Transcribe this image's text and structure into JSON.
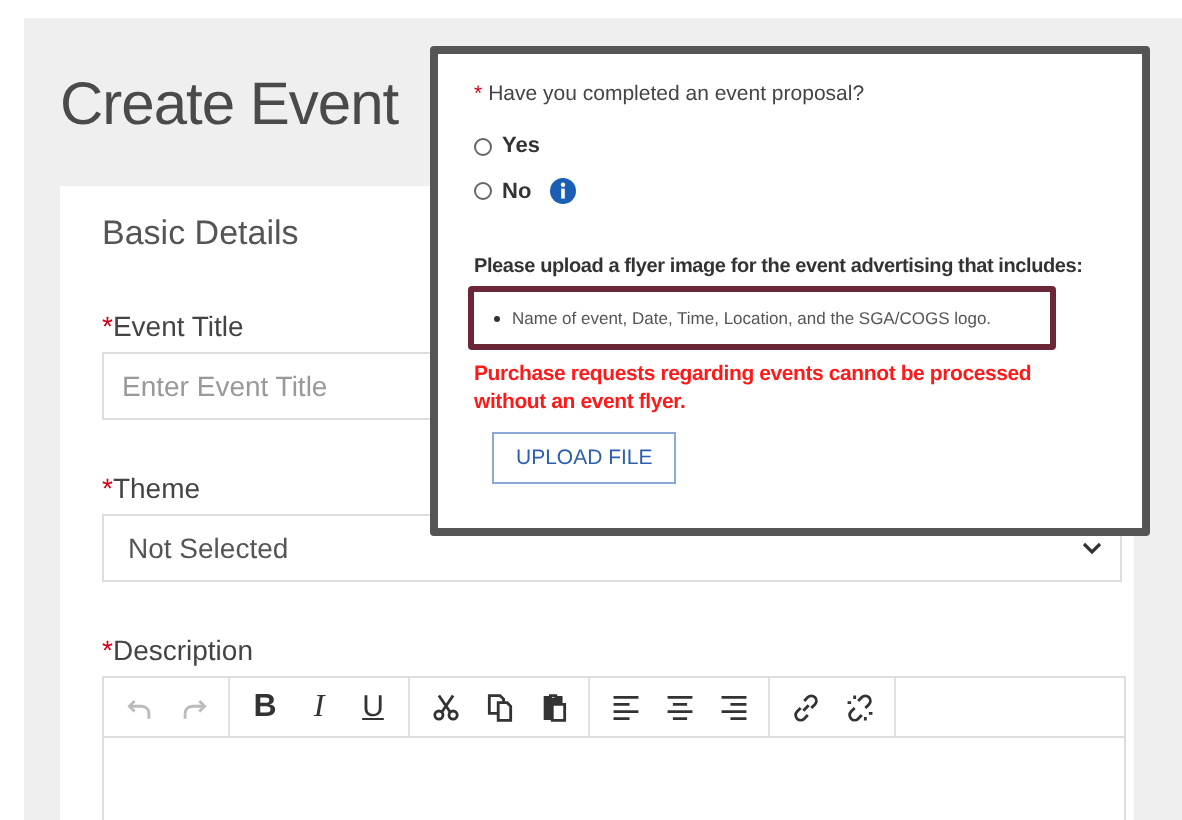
{
  "page": {
    "title": "Create Event"
  },
  "card": {
    "heading": "Basic Details",
    "fields": [
      {
        "kind": "text",
        "marker": "*",
        "label": "Event Title",
        "placeholder": "Enter Event Title"
      },
      {
        "kind": "select",
        "marker": "*",
        "label": "Theme",
        "value": "Not Selected"
      },
      {
        "kind": "editor",
        "marker": "*",
        "label": "Description"
      }
    ],
    "toolbar": [
      [
        {
          "kind": "undo",
          "disabled": true
        },
        {
          "kind": "redo",
          "disabled": true
        }
      ],
      [
        {
          "kind": "bold",
          "label": "B",
          "disabled": false
        },
        {
          "kind": "italic",
          "label": "I",
          "disabled": false
        },
        {
          "kind": "underline",
          "label": "U",
          "disabled": false
        }
      ],
      [
        {
          "kind": "cut",
          "disabled": false
        },
        {
          "kind": "copy",
          "disabled": false
        },
        {
          "kind": "paste",
          "disabled": false
        }
      ],
      [
        {
          "kind": "align-left",
          "disabled": false
        },
        {
          "kind": "align-center",
          "disabled": false
        },
        {
          "kind": "align-right",
          "disabled": false
        }
      ],
      [
        {
          "kind": "link",
          "disabled": false
        },
        {
          "kind": "unlink",
          "disabled": false
        }
      ]
    ]
  },
  "popup": {
    "marker": "*",
    "question": "Have you completed an event proposal?",
    "options": [
      {
        "label": "Yes",
        "selected": false,
        "info": false
      },
      {
        "label": "No",
        "selected": false,
        "info": true
      }
    ],
    "upload_prompt": "Please upload a flyer image for the event advertising that includes:",
    "requirements": [
      "Name of event, Date, Time, Location, and the SGA/COGS logo."
    ],
    "warning": "Purchase requests regarding events cannot be processed without an event flyer.",
    "button": "UPLOAD FILE"
  }
}
